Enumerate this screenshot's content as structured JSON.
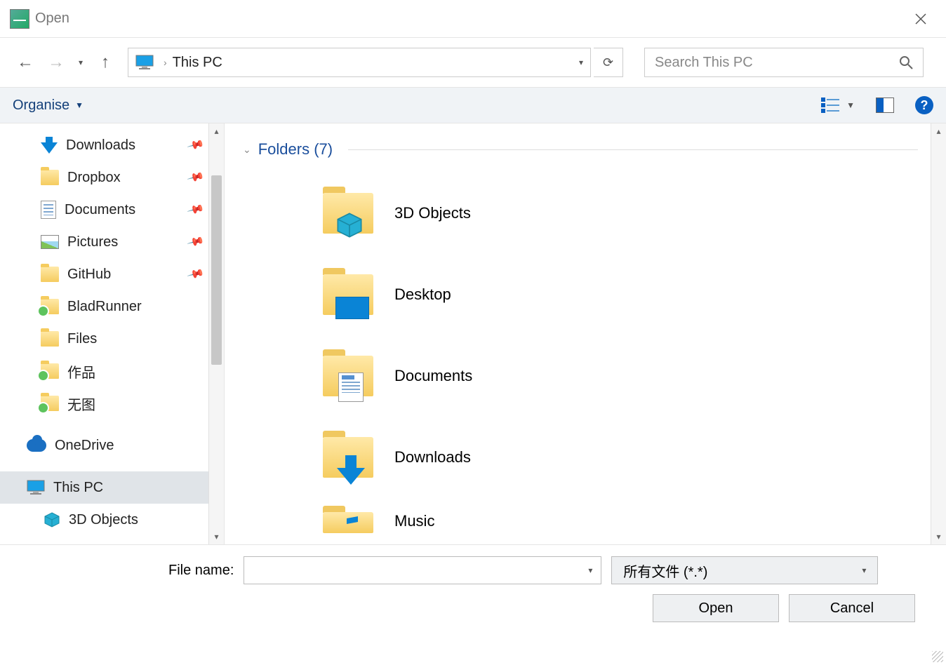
{
  "titlebar": {
    "title": "Open"
  },
  "addressbar": {
    "location": "This PC"
  },
  "searchbox": {
    "placeholder": "Search This PC"
  },
  "toolbar": {
    "organise": "Organise"
  },
  "sidebar": {
    "items": [
      {
        "label": "Downloads",
        "pinned": true,
        "icon": "download"
      },
      {
        "label": "Dropbox",
        "pinned": true,
        "icon": "folder"
      },
      {
        "label": "Documents",
        "pinned": true,
        "icon": "document"
      },
      {
        "label": "Pictures",
        "pinned": true,
        "icon": "picture"
      },
      {
        "label": "GitHub",
        "pinned": true,
        "icon": "folder"
      },
      {
        "label": "BladRunner",
        "pinned": false,
        "icon": "folder-sync"
      },
      {
        "label": "Files",
        "pinned": false,
        "icon": "folder"
      },
      {
        "label": "作品",
        "pinned": false,
        "icon": "folder-sync"
      },
      {
        "label": "无图",
        "pinned": false,
        "icon": "folder-sync"
      }
    ],
    "onedrive": "OneDrive",
    "thispc": "This PC",
    "thispc_children": [
      {
        "label": "3D Objects"
      }
    ]
  },
  "content": {
    "section_title": "Folders (7)",
    "folders": [
      {
        "label": "3D Objects",
        "overlay": "cube"
      },
      {
        "label": "Desktop",
        "overlay": "desktop"
      },
      {
        "label": "Documents",
        "overlay": "document"
      },
      {
        "label": "Downloads",
        "overlay": "download"
      },
      {
        "label": "Music",
        "overlay": "music"
      }
    ]
  },
  "bottom": {
    "file_name_label": "File name:",
    "filter": "所有文件 (*.*)",
    "open": "Open",
    "cancel": "Cancel"
  }
}
